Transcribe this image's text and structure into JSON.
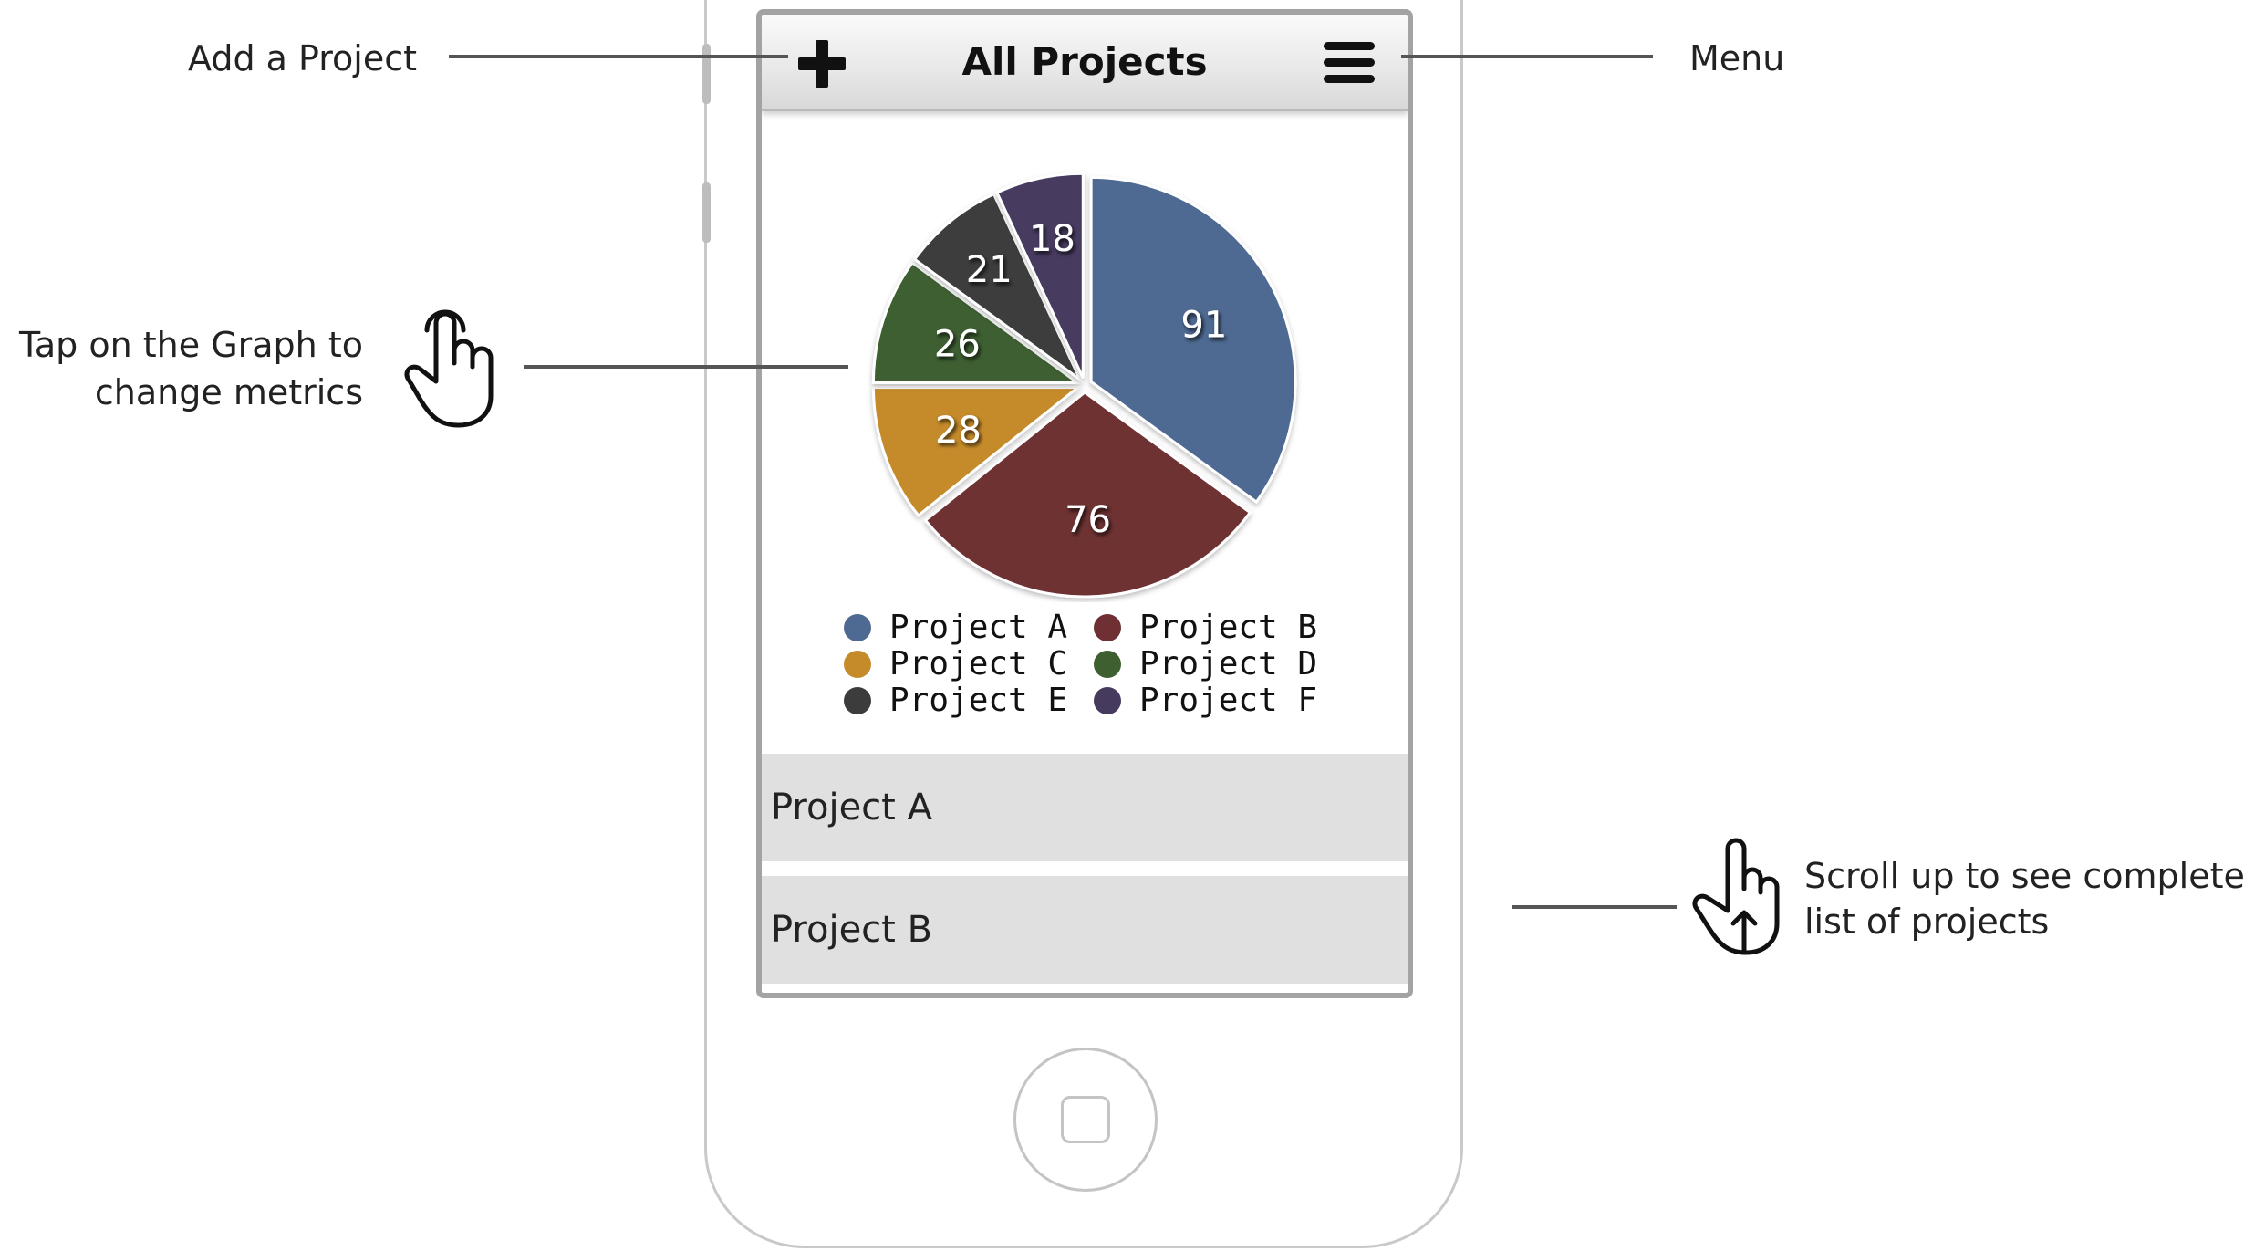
{
  "annotations": {
    "add_project": "Add a Project",
    "menu": "Menu",
    "tap_graph_line1": "Tap on the Graph to",
    "tap_graph_line2": "change metrics",
    "scroll_line1": "Scroll up to see complete",
    "scroll_line2": "list of projects"
  },
  "navbar": {
    "title": "All Projects",
    "add_icon": "plus-icon",
    "menu_icon": "hamburger-icon"
  },
  "chart_data": {
    "type": "pie",
    "slices": [
      {
        "label": "Project A",
        "value": 91,
        "color": "#4f6a92"
      },
      {
        "label": "Project B",
        "value": 76,
        "color": "#6e3033"
      },
      {
        "label": "Project C",
        "value": 28,
        "color": "#c58b2b"
      },
      {
        "label": "Project D",
        "value": 26,
        "color": "#3e5f30"
      },
      {
        "label": "Project E",
        "value": 21,
        "color": "#3c3c3c"
      },
      {
        "label": "Project F",
        "value": 18,
        "color": "#463a5e"
      }
    ],
    "legend_placement": "bottom"
  },
  "project_list": [
    {
      "name": "Project A"
    },
    {
      "name": "Project B"
    }
  ]
}
